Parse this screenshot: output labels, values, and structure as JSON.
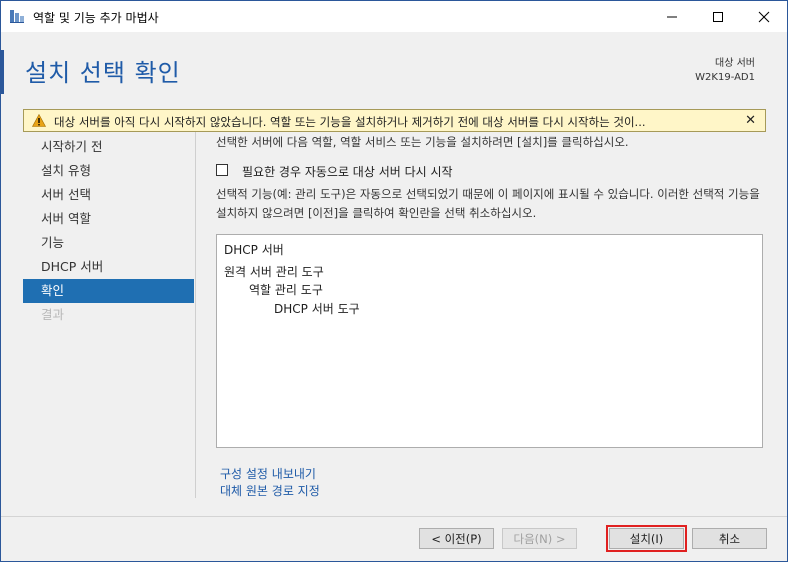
{
  "window": {
    "title": "역할 및 기능 추가 마법사",
    "controls": {
      "minimize": "—",
      "maximize": "☐",
      "close": "✕"
    }
  },
  "header": {
    "title": "설치 선택 확인",
    "server_caption": "대상 서버",
    "server_name": "W2K19-AD1"
  },
  "warning": {
    "text": "대상 서버를 아직 다시 시작하지 않았습니다. 역할 또는 기능을 설치하거나 제거하기 전에 대상 서버를 다시 시작하는 것이...",
    "close": "✕",
    "icon": "warning-icon"
  },
  "nav": {
    "items": [
      {
        "label": "시작하기 전",
        "state": "normal"
      },
      {
        "label": "설치 유형",
        "state": "normal"
      },
      {
        "label": "서버 선택",
        "state": "normal"
      },
      {
        "label": "서버 역할",
        "state": "normal"
      },
      {
        "label": "기능",
        "state": "normal"
      },
      {
        "label": "DHCP 서버",
        "state": "normal"
      },
      {
        "label": "확인",
        "state": "active"
      },
      {
        "label": "결과",
        "state": "disabled"
      }
    ]
  },
  "content": {
    "intro": "선택한 서버에 다음 역할, 역할 서비스 또는 기능을 설치하려면 [설치]를 클릭하십시오.",
    "restart_checkbox": {
      "label": "필요한 경우 자동으로 대상 서버 다시 시작",
      "checked": false
    },
    "note": "선택적 기능(예: 관리 도구)은 자동으로 선택되었기 때문에 이 페이지에 표시될 수 있습니다. 이러한 선택적 기능을 설치하지 않으려면 [이전]을 클릭하여 확인란을 선택 취소하십시오.",
    "selection_list": [
      {
        "label": "DHCP 서버",
        "level": 0
      },
      {
        "label": "원격 서버 관리 도구",
        "level": 0
      },
      {
        "label": "역할 관리 도구",
        "level": 1
      },
      {
        "label": "DHCP 서버 도구",
        "level": 2
      }
    ],
    "links": {
      "export": "구성 설정 내보내기",
      "alt_source": "대체 원본 경로 지정"
    }
  },
  "footer": {
    "prev": "< 이전(P)",
    "next": "다음(N) >",
    "install": "설치(I)",
    "cancel": "취소"
  },
  "colors": {
    "accent": "#1f5ba8",
    "nav_active": "#1f6fb2",
    "warning_bg": "#fff6c8",
    "highlight_ring": "#e02020"
  }
}
